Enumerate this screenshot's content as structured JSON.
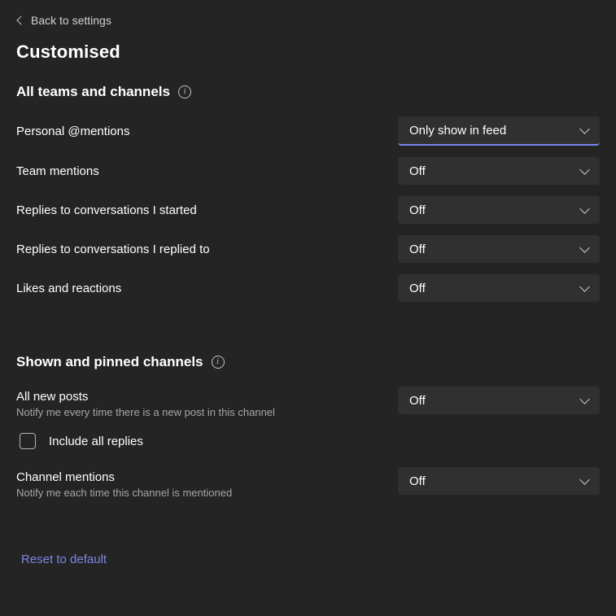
{
  "back": "Back to settings",
  "title": "Customised",
  "section1": {
    "title": "All teams and channels",
    "rows": [
      {
        "label": "Personal @mentions",
        "value": "Only show in feed"
      },
      {
        "label": "Team mentions",
        "value": "Off"
      },
      {
        "label": "Replies to conversations I started",
        "value": "Off"
      },
      {
        "label": "Replies to conversations I replied to",
        "value": "Off"
      },
      {
        "label": "Likes and reactions",
        "value": "Off"
      }
    ]
  },
  "section2": {
    "title": "Shown and pinned channels",
    "row_posts": {
      "label": "All new posts",
      "sub": "Notify me every time there is a new post in this channel",
      "value": "Off"
    },
    "checkbox_label": "Include all replies",
    "row_mentions": {
      "label": "Channel mentions",
      "sub": "Notify me each time this channel is mentioned",
      "value": "Off"
    }
  },
  "reset": "Reset to default"
}
